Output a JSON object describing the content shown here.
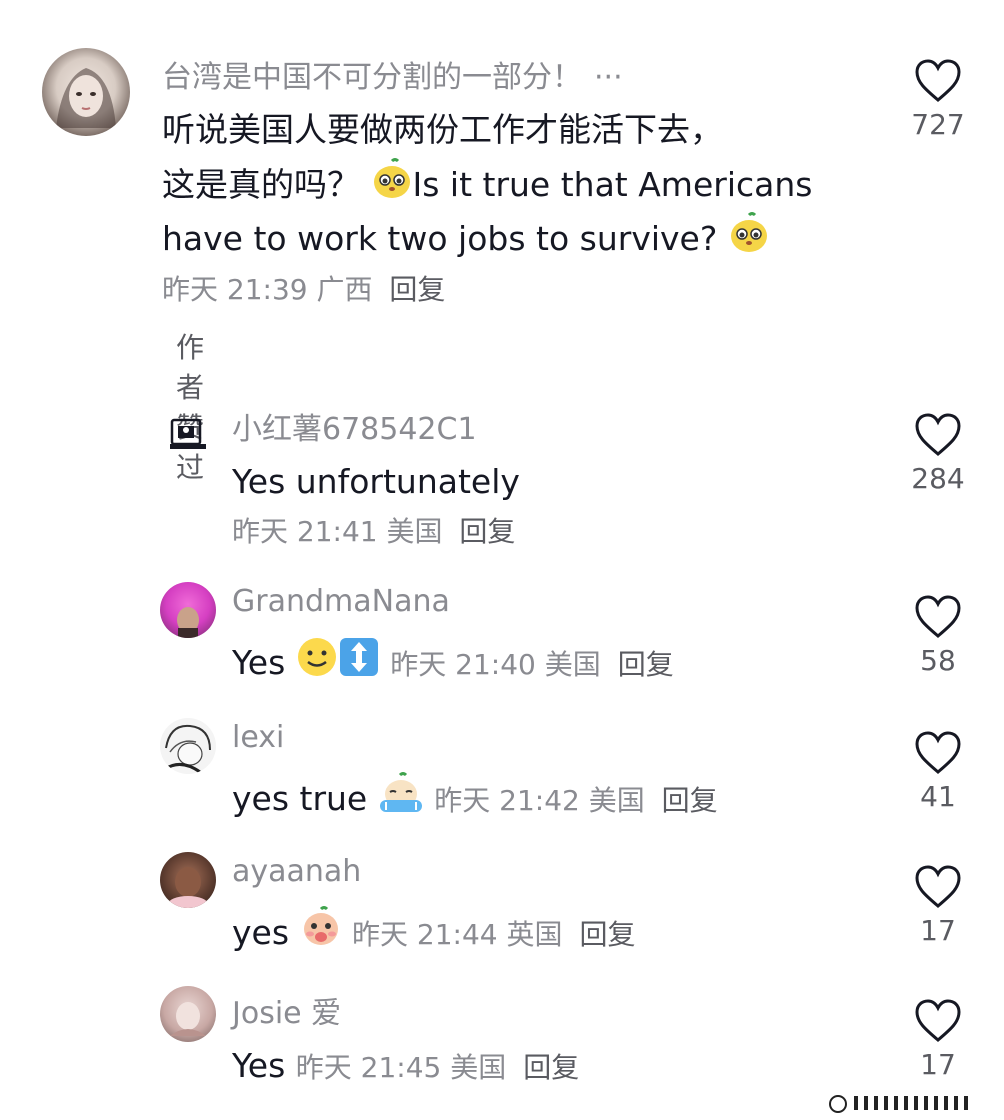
{
  "main_comment": {
    "username": "台湾是中国不可分割的一部分！",
    "more_label": "···",
    "text_line1": "听说美国人要做两份工作才能活下去，",
    "text_line2": "这是真的吗？",
    "text_line2b": "Is it true that Americans",
    "text_line3": "have to work two jobs to survive?",
    "time": "昨天 21:39",
    "location": "广西",
    "reply_label": "回复",
    "like_count": "727",
    "author_liked": "作者赞过"
  },
  "replies": [
    {
      "username": "小红薯678542C1",
      "text": "Yes unfortunately",
      "time": "昨天 21:41",
      "location": "美国",
      "reply_label": "回复",
      "like_count": "284",
      "avatar_icon": "image-placeholder-icon"
    },
    {
      "username": "GrandmaNana",
      "text": "Yes",
      "time": "昨天 21:40",
      "location": "美国",
      "reply_label": "回复",
      "like_count": "58",
      "emojis": [
        "smiley-icon",
        "up-down-arrow-icon"
      ]
    },
    {
      "username": "lexi",
      "text": "yes true",
      "time": "昨天 21:42",
      "location": "美国",
      "reply_label": "回复",
      "like_count": "41",
      "emojis": [
        "crying-emoji-icon"
      ]
    },
    {
      "username": "ayaanah",
      "text": "yes",
      "time": "昨天 21:44",
      "location": "英国",
      "reply_label": "回复",
      "like_count": "17",
      "emojis": [
        "shocked-emoji-icon"
      ]
    },
    {
      "username": "Josie 爱",
      "text": "Yes",
      "time": "昨天 21:45",
      "location": "美国",
      "reply_label": "回复",
      "like_count": "17"
    }
  ],
  "colors": {
    "text_primary": "#161823",
    "text_secondary": "#8a8b91",
    "like_outline": "#161823"
  }
}
